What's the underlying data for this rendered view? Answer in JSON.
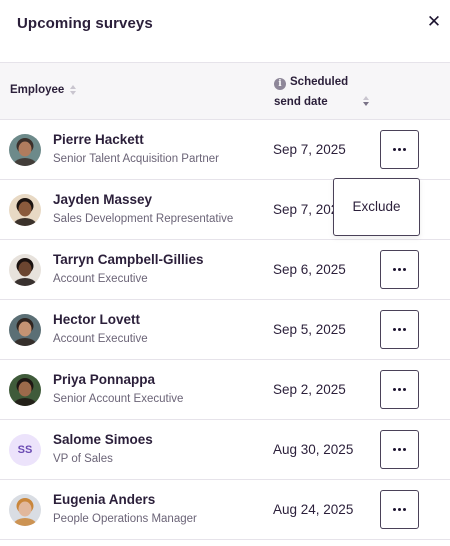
{
  "header": {
    "title": "Upcoming surveys",
    "close_glyph": "✕"
  },
  "table": {
    "columns": [
      {
        "label": "Employee",
        "sort_state": "none"
      },
      {
        "label": "Scheduled send date",
        "line1": "Scheduled",
        "line2": "send date",
        "info_icon": "info-icon",
        "sort_state": "descending"
      }
    ],
    "rows": [
      {
        "name": "Pierre Hackett",
        "role": "Senior Talent Acquisition Partner",
        "date": "Sep 7, 2025",
        "avatar": {
          "type": "photo",
          "skin": "#b07c5e",
          "hair": "#3b2f2a",
          "bg": "#6d8a8a"
        }
      },
      {
        "name": "Jayden Massey",
        "role": "Sales Development Representative",
        "date": "Sep 7, 2025",
        "avatar": {
          "type": "photo",
          "skin": "#8a5a3c",
          "hair": "#1c1411",
          "bg": "#e8d9c4"
        }
      },
      {
        "name": "Tarryn Campbell-Gillies",
        "role": "Account Executive",
        "date": "Sep 6, 2025",
        "avatar": {
          "type": "photo",
          "skin": "#6b4530",
          "hair": "#1a1210",
          "bg": "#e7e2dc"
        }
      },
      {
        "name": "Hector Lovett",
        "role": "Account Executive",
        "date": "Sep 5, 2025",
        "avatar": {
          "type": "photo",
          "skin": "#c49373",
          "hair": "#2f241f",
          "bg": "#5b6f75"
        }
      },
      {
        "name": "Priya Ponnappa",
        "role": "Senior Account Executive",
        "date": "Sep 2, 2025",
        "avatar": {
          "type": "photo",
          "skin": "#9c6a4b",
          "hair": "#1e1714",
          "bg": "#3f5b3a"
        }
      },
      {
        "name": "Salome Simoes",
        "role": "VP of Sales",
        "date": "Aug 30, 2025",
        "avatar": {
          "type": "initials",
          "initials": "SS"
        }
      },
      {
        "name": "Eugenia Anders",
        "role": "People Operations Manager",
        "date": "Aug 24, 2025",
        "avatar": {
          "type": "photo",
          "skin": "#e1b79b",
          "hair": "#c9863a",
          "bg": "#d9dde3"
        }
      }
    ]
  },
  "popover": {
    "row_index": 1,
    "item_label": "Exclude"
  },
  "colors": {
    "text": "#2b1f3a",
    "muted": "#6b6477",
    "header_bg": "#f7f6f8",
    "border": "#e6e3ea",
    "initials_bg": "#ece3fb",
    "initials_fg": "#6b4bb3"
  }
}
